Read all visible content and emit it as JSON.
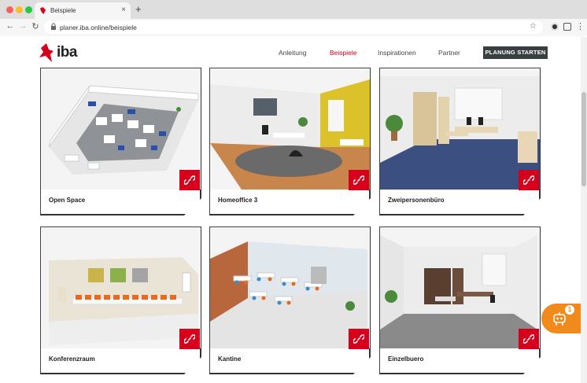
{
  "browser": {
    "tab_title": "Beispiele",
    "url": "planer.iba.online/beispiele"
  },
  "site": {
    "logo_text": "iba",
    "nav": [
      "Anleitung",
      "Beispiele",
      "Inspirationen",
      "Partner"
    ],
    "active_nav": "Beispiele",
    "cta_label": "PLANUNG STARTEN",
    "accent_color": "#d6001c"
  },
  "cards": [
    {
      "title": "Open Space"
    },
    {
      "title": "Homeoffice 3"
    },
    {
      "title": "Zweipersonenbüro"
    },
    {
      "title": "Konferenzraum"
    },
    {
      "title": "Kantine"
    },
    {
      "title": "Einzelbuero"
    }
  ],
  "chat_widget": {
    "badge": "1",
    "icon": "robot-icon"
  }
}
